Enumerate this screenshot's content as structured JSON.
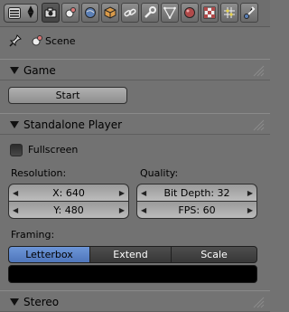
{
  "header": {
    "tabs": [
      "render-icon",
      "scene-icon",
      "world-icon",
      "object-icon",
      "constraints-icon",
      "modifier-icon",
      "mesh-data-icon",
      "material-icon",
      "texture-icon",
      "particles-icon",
      "physics-icon"
    ],
    "active_tab": 0
  },
  "context": {
    "scene_label": "Scene"
  },
  "panels": {
    "game": {
      "title": "Game",
      "start_label": "Start"
    },
    "standalone": {
      "title": "Standalone Player",
      "fullscreen_label": "Fullscreen",
      "fullscreen_checked": false,
      "resolution_label": "Resolution:",
      "res_x": "X: 640",
      "res_y": "Y: 480",
      "quality_label": "Quality:",
      "bit_depth": "Bit Depth: 32",
      "fps": "FPS: 60",
      "framing_label": "Framing:",
      "framing_options": [
        "Letterbox",
        "Extend",
        "Scale"
      ],
      "framing_selected": "Letterbox",
      "bar_color": "#000000"
    },
    "stereo": {
      "title": "Stereo"
    }
  },
  "colors": {
    "accent": "#5a84c9",
    "background": "#727272"
  }
}
